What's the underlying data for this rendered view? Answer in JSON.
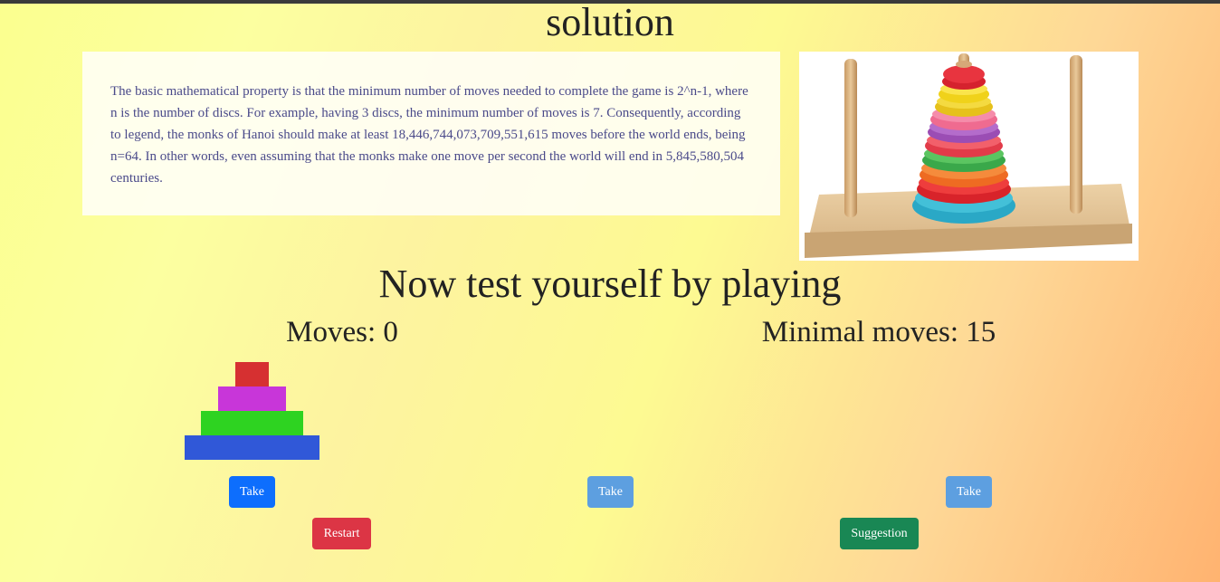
{
  "page": {
    "solution_title": "solution",
    "explanation": "The basic mathematical property is that the minimum number of moves needed to complete the game is 2^n-1, where n is the number of discs. For example, having 3 discs, the minimum number of moves is 7. Consequently, according to legend, the monks of Hanoi should make at least 18,446,744,073,709,551,615 moves before the world ends, being n=64. In other words, even assuming that the monks make one move per second the world will end in 5,845,580,504 centuries.",
    "test_title": "Now test yourself by playing"
  },
  "game": {
    "moves_text": "Moves: 0",
    "minimal_moves_text": "Minimal moves: 15",
    "towers": [
      {
        "discs": [
          {
            "color": "#d63031"
          },
          {
            "color": "#c836d9"
          },
          {
            "color": "#2ed321"
          },
          {
            "color": "#3058d8"
          }
        ],
        "take_label": "Take",
        "take_enabled": true
      },
      {
        "discs": [],
        "take_label": "Take",
        "take_enabled": false
      },
      {
        "discs": [],
        "take_label": "Take",
        "take_enabled": false
      }
    ],
    "restart_label": "Restart",
    "suggestion_label": "Suggestion"
  },
  "colors": {
    "take_active": "#0d6efd",
    "take_disabled": "#5d9fe0",
    "restart": "#dc3545",
    "suggestion": "#198754"
  },
  "photo": {
    "icon": "tower-of-hanoi-toy-image"
  }
}
